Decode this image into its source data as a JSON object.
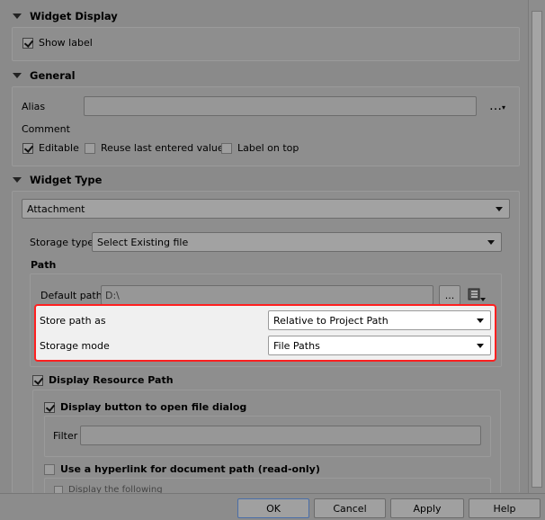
{
  "widget_display": {
    "title": "Widget Display",
    "show_label": "Show label"
  },
  "general": {
    "title": "General",
    "alias_label": "Alias",
    "alias_value": "",
    "comment_label": "Comment",
    "editable": "Editable",
    "reuse_last": "Reuse last entered value",
    "label_on_top": "Label on top",
    "more_glyph": "…"
  },
  "widget_type": {
    "title": "Widget Type",
    "type_value": "Attachment",
    "storage_type_label": "Storage type",
    "storage_type_value": "Select Existing file",
    "path_title": "Path",
    "default_path_label": "Default path",
    "default_path_value": "D:\\",
    "browse_label": "...",
    "store_path_as_label": "Store path as",
    "store_path_as_value": "Relative to Project Path",
    "storage_mode_label": "Storage mode",
    "storage_mode_value": "File Paths",
    "display_resource_path": "Display Resource Path",
    "display_button_open": "Display button to open file dialog",
    "filter_label": "Filter",
    "filter_value": "",
    "use_hyperlink": "Use a hyperlink for document path (read-only)",
    "display_following": "Display the following"
  },
  "buttons": {
    "ok": "OK",
    "cancel": "Cancel",
    "apply": "Apply",
    "help": "Help"
  },
  "colors": {
    "highlight_border": "#ff2020",
    "highlight_bg": "#f0f0f0",
    "dim_bg": "#8a8a8a"
  }
}
